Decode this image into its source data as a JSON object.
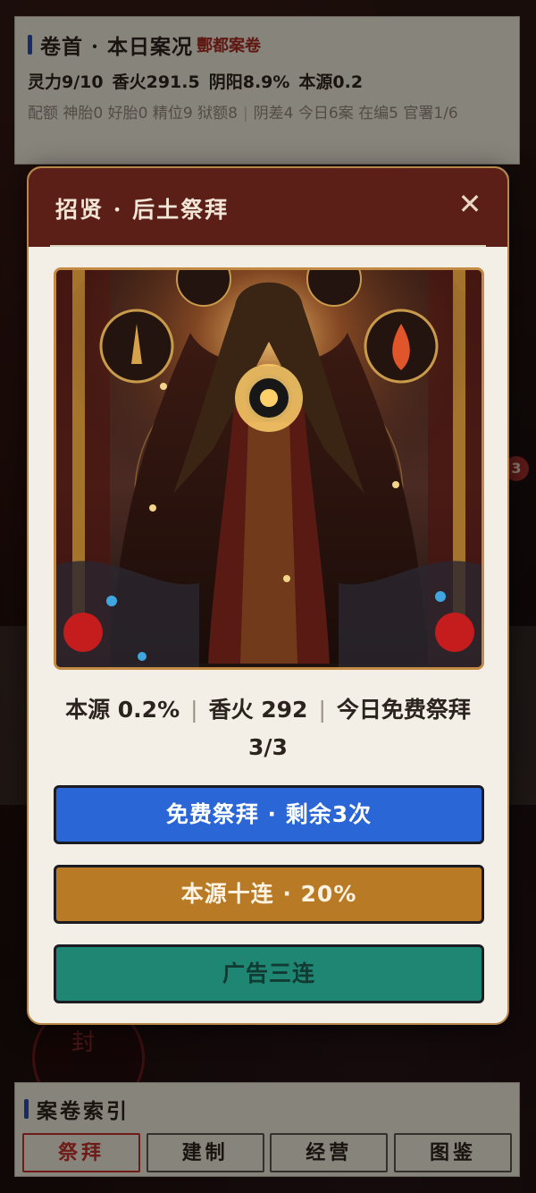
{
  "status_panel": {
    "title": "卷首 · 本日案况",
    "tag": "酆都案卷",
    "stats": [
      "灵力9/10",
      "香火291.5",
      "阴阳8.9%",
      "本源0.2"
    ],
    "quota_label": "配额",
    "quotas": [
      "神胎0",
      "好胎0",
      "精位9",
      "狱额8"
    ],
    "staff": [
      "阴差4",
      "今日6案",
      "在编5",
      "官署1/6"
    ]
  },
  "background": {
    "seal_char": "封",
    "side_badge": "3"
  },
  "modal": {
    "title": "招贤 · 后土祭拜",
    "close_glyph": "✕",
    "stat_origin": "本源 0.2%",
    "stat_incense": "香火 292",
    "stat_free": "今日免费祭拜 3/3",
    "buttons": {
      "free": "免费祭拜 · 剩余3次",
      "ten_pull": "本源十连 · 20%",
      "ad_triple": "广告三连"
    }
  },
  "index_panel": {
    "title": "案卷索引",
    "tabs": [
      "祭拜",
      "建制",
      "经营",
      "图鉴"
    ],
    "active_tab": "祭拜"
  },
  "colors": {
    "modal_header": "#5b1f17",
    "free_button": "#2a66d5",
    "ten_button": "#b97a25",
    "ad_button": "#1e8672",
    "accent_red": "#a4281f"
  }
}
